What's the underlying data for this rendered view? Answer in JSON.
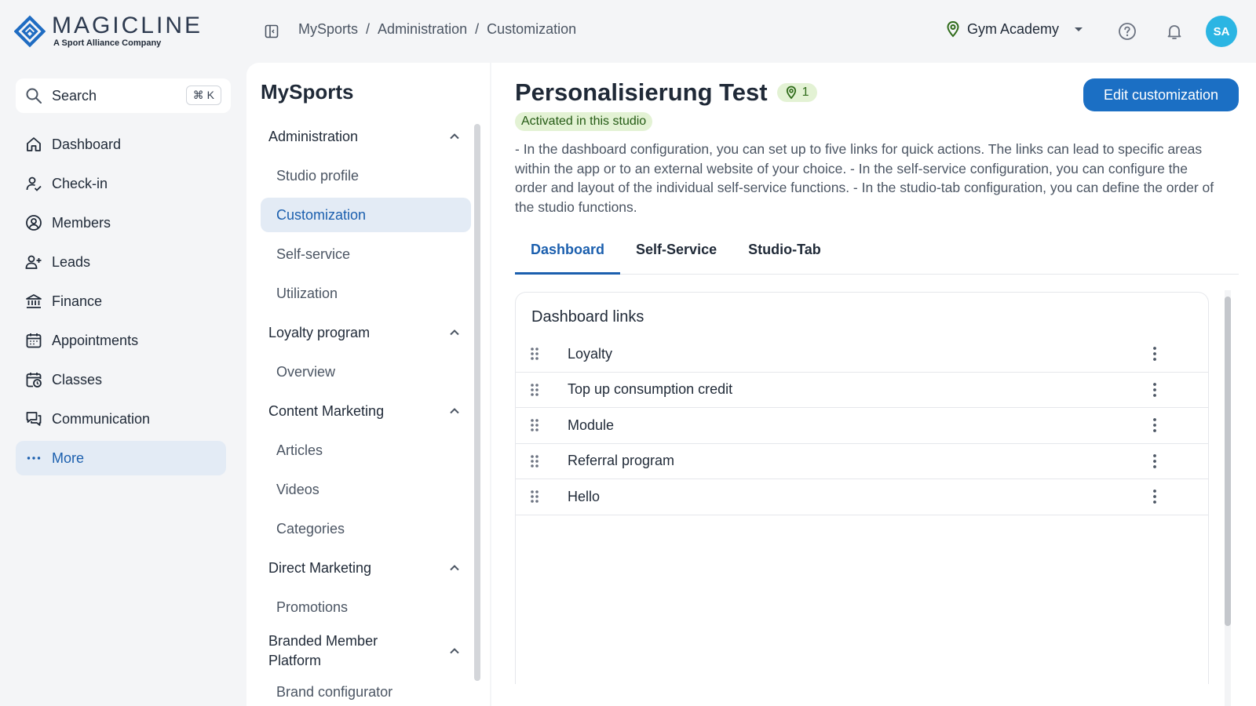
{
  "brand": {
    "name": "MAGICLINE",
    "tagline": "A Sport Alliance Company",
    "color": "#1f6cc2"
  },
  "breadcrumb": [
    "MySports",
    "Administration",
    "Customization"
  ],
  "header": {
    "studio": "Gym Academy",
    "avatar_initials": "SA",
    "avatar_color": "#2bb5e3"
  },
  "search": {
    "label": "Search",
    "shortcut": "⌘ K"
  },
  "nav": {
    "items": [
      {
        "label": "Dashboard",
        "icon": "home-icon"
      },
      {
        "label": "Check-in",
        "icon": "user-check-icon"
      },
      {
        "label": "Members",
        "icon": "user-circle-icon"
      },
      {
        "label": "Leads",
        "icon": "user-plus-icon"
      },
      {
        "label": "Finance",
        "icon": "bank-icon"
      },
      {
        "label": "Appointments",
        "icon": "calendar-icon"
      },
      {
        "label": "Classes",
        "icon": "calendar-clock-icon"
      },
      {
        "label": "Communication",
        "icon": "chat-icon"
      },
      {
        "label": "More",
        "icon": "more-dots-icon",
        "active": true
      }
    ]
  },
  "subnav": {
    "title": "MySports",
    "groups": [
      {
        "label": "Administration",
        "items": [
          "Studio profile",
          "Customization",
          "Self-service",
          "Utilization"
        ]
      },
      {
        "label": "Loyalty program",
        "items": [
          "Overview"
        ]
      },
      {
        "label": "Content Marketing",
        "items": [
          "Articles",
          "Videos",
          "Categories"
        ]
      },
      {
        "label": "Direct Marketing",
        "items": [
          "Promotions"
        ]
      },
      {
        "label": "Branded Member Platform",
        "items": [
          "Brand configurator"
        ]
      }
    ],
    "active_item": "Customization"
  },
  "main": {
    "title": "Personalisierung Test",
    "location_count": "1",
    "edit_button": "Edit customization",
    "status": "Activated in this studio",
    "description": "- In the dashboard configuration, you can set up to five links for quick actions. The links can lead to specific areas within the app or to an external website of your choice. - In the self-service configuration, you can configure the order and layout of the individual self-service functions. - In the studio-tab configuration, you can define the order of the studio functions.",
    "tabs": [
      "Dashboard",
      "Self-Service",
      "Studio-Tab"
    ],
    "active_tab": "Dashboard",
    "card_title": "Dashboard links",
    "links": [
      "Loyalty",
      "Top up consumption credit",
      "Module",
      "Referral program",
      "Hello"
    ]
  }
}
